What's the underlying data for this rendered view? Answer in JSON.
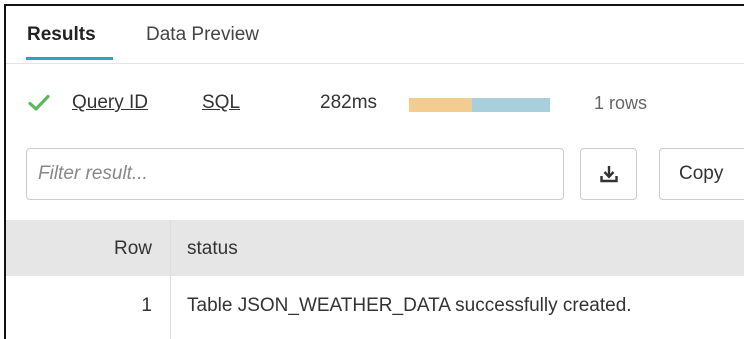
{
  "tabs": {
    "results": "Results",
    "preview": "Data Preview"
  },
  "query": {
    "status_icon": "check-icon",
    "query_id_label": "Query ID",
    "sql_label": "SQL",
    "duration": "282ms",
    "timing_segments": [
      {
        "fraction": 0.45,
        "color": "#f2cd8f"
      },
      {
        "fraction": 0.55,
        "color": "#a8cfdc"
      }
    ],
    "rows": "1 rows"
  },
  "filter": {
    "placeholder": "Filter result...",
    "value": ""
  },
  "toolbar": {
    "download_icon": "download-icon",
    "copy_label": "Copy"
  },
  "table": {
    "columns": [
      "Row",
      "status"
    ],
    "rows": [
      {
        "row": "1",
        "status": "Table JSON_WEATHER_DATA successfully created."
      }
    ]
  },
  "colors": {
    "accent": "#2aa2c9",
    "success": "#5cb85c",
    "header_bg": "#e6e6e6"
  }
}
